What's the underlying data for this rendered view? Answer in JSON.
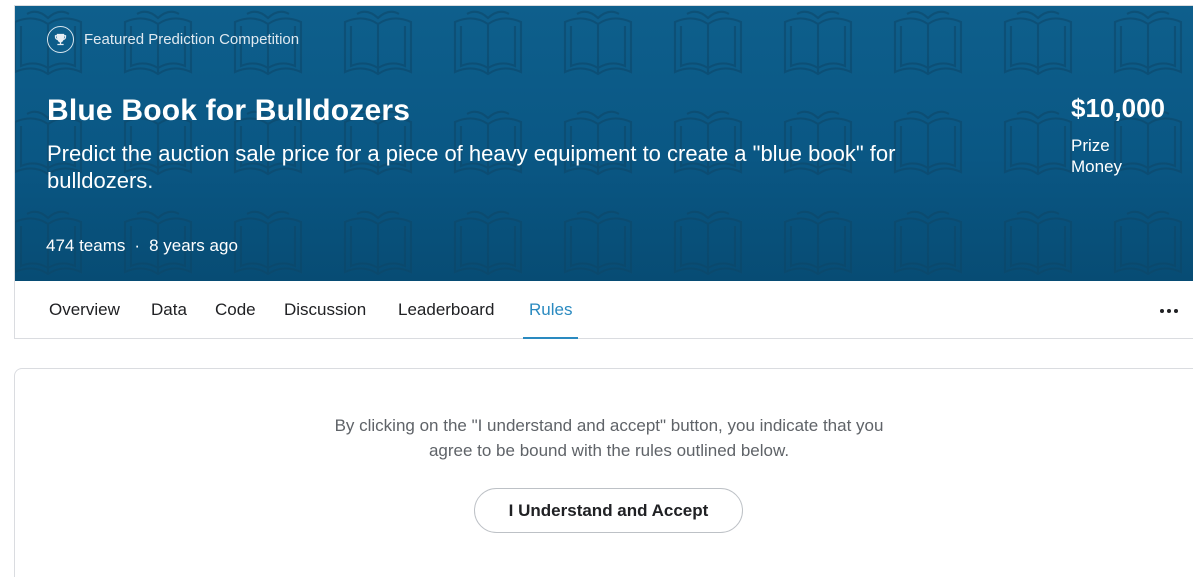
{
  "hero": {
    "badge_icon": "trophy-icon",
    "badge_label": "Featured Prediction Competition",
    "title": "Blue Book for Bulldozers",
    "subtitle": "Predict the auction sale price for a piece of heavy equipment to create a \"blue book\" for bulldozers.",
    "teams": "474 teams",
    "separator": "·",
    "age": "8 years ago",
    "prize_amount": "$10,000",
    "prize_label": "Prize Money",
    "background_color": "#0a5784",
    "pattern_icon": "open-book-icon"
  },
  "tabs": {
    "items": [
      {
        "label": "Overview"
      },
      {
        "label": "Data"
      },
      {
        "label": "Code"
      },
      {
        "label": "Discussion"
      },
      {
        "label": "Leaderboard"
      },
      {
        "label": "Rules"
      }
    ],
    "active": "Rules",
    "active_color": "#2a8ac0",
    "more_icon": "more-horizontal-icon"
  },
  "rules": {
    "notice_line1": "By clicking on the \"I understand and accept\" button, you indicate that you",
    "notice_line2": "agree to be bound with the rules outlined below.",
    "accept_label": "I Understand and Accept"
  }
}
